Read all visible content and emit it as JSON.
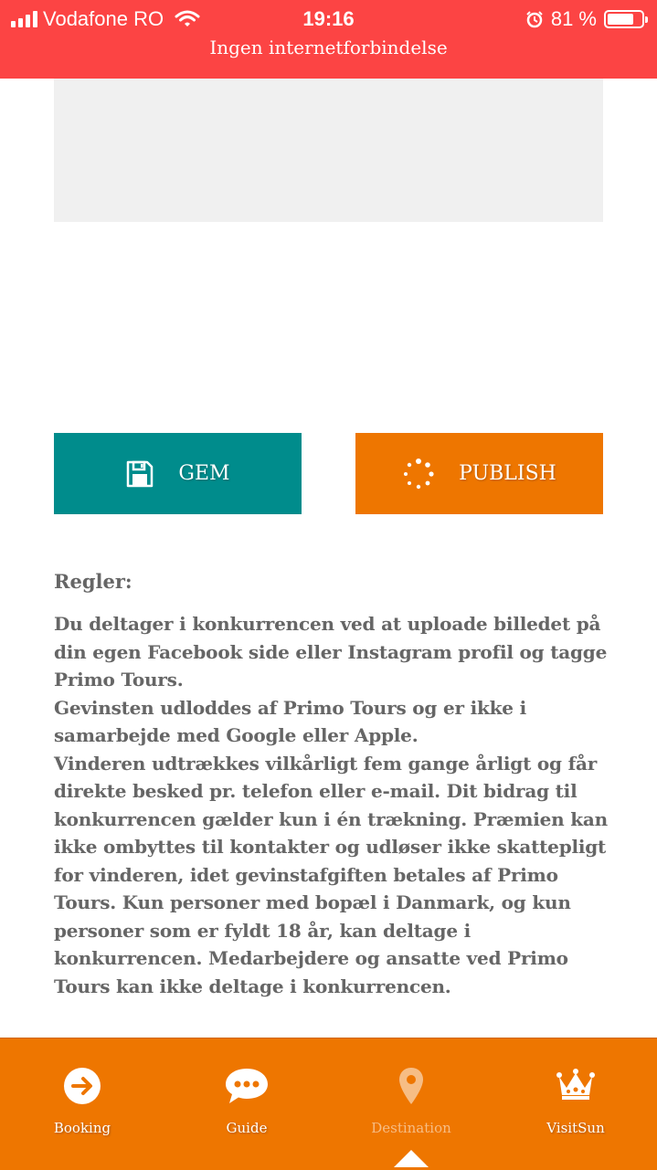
{
  "status_bar": {
    "carrier": "Vodafone RO",
    "time": "19:16",
    "battery_percent": "81 %",
    "battery_level": 0.81,
    "notice": "Ingen internetforbindelse",
    "background_color": "#fc4444"
  },
  "actions": {
    "save_label": "GEM",
    "publish_label": "PUBLISH",
    "save_color": "#008c8c",
    "publish_color": "#ee7600"
  },
  "rules": {
    "heading": "Regler:",
    "body": "Du deltager i konkurrencen ved at uploade billedet på din egen Facebook side eller Instagram profil og tagge Primo Tours.\nGevinsten udloddes af Primo Tours og er ikke i samarbejde med Google eller Apple.\nVinderen udtrækkes vilkårligt fem gange årligt og får direkte besked pr. telefon eller e-mail. Dit bidrag til konkurrencen gælder kun i én trækning. Præmien kan ikke ombyttes til kontakter og udløser ikke skattepligt for vinderen, idet gevinstafgiften betales af Primo Tours. Kun personer med bopæl i Danmark, og kun personer som er fyldt 18 år, kan deltage i konkurrencen. Medarbejdere og ansatte ved Primo Tours kan ikke deltage i konkurrencen."
  },
  "tab_bar": {
    "background_color": "#ee7600",
    "tabs": [
      {
        "label": "Booking",
        "icon": "arrow-right-circle-icon"
      },
      {
        "label": "Guide",
        "icon": "chat-bubble-icon"
      },
      {
        "label": "Destination",
        "icon": "map-pin-icon",
        "active": true
      },
      {
        "label": "VisitSun",
        "icon": "crown-icon"
      }
    ]
  }
}
